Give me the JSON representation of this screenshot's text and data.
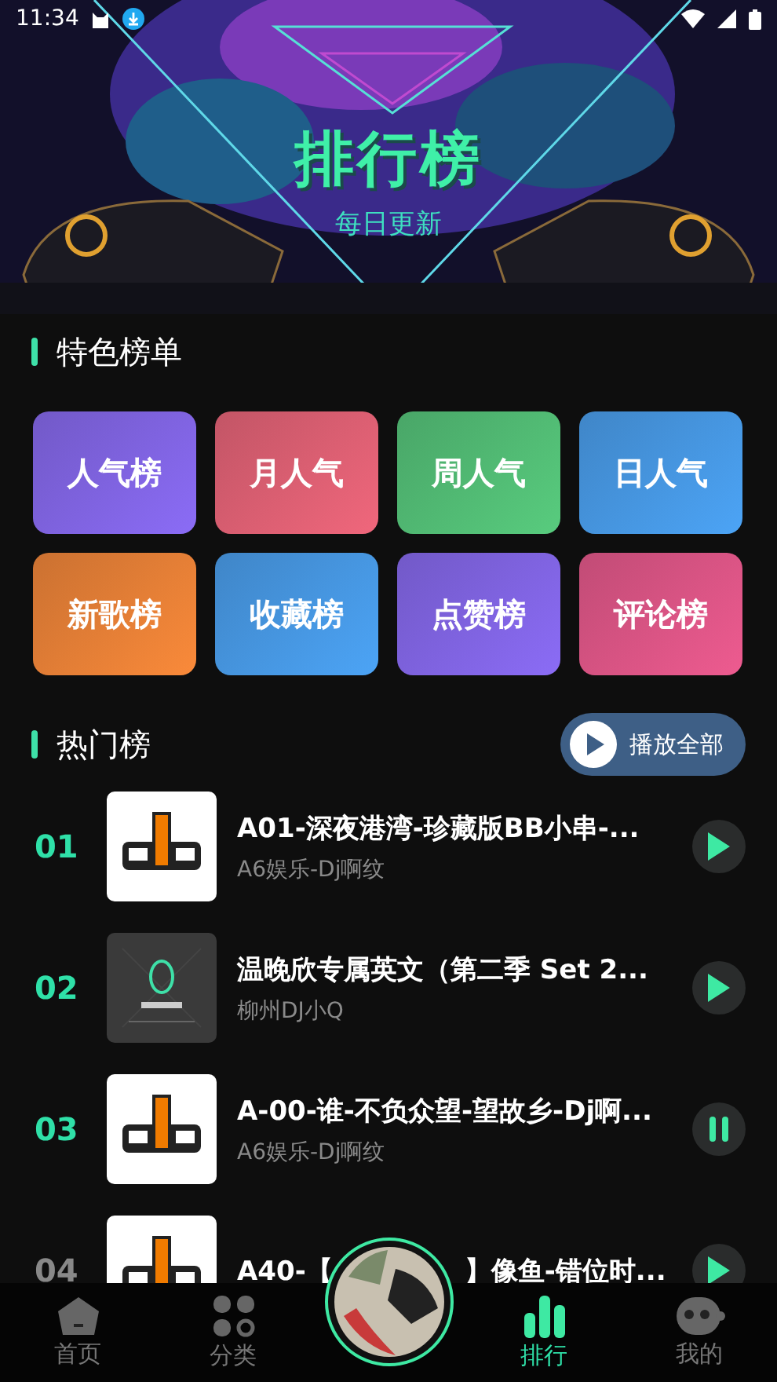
{
  "status_bar": {
    "time": "11:34"
  },
  "banner": {
    "title": "排行榜",
    "subtitle": "每日更新"
  },
  "featured": {
    "heading": "特色榜单",
    "tiles": [
      {
        "label": "人气榜",
        "color": "#8b6cf6"
      },
      {
        "label": "月人气",
        "color": "#f0677c"
      },
      {
        "label": "周人气",
        "color": "#58cc7e"
      },
      {
        "label": "日人气",
        "color": "#4ca4f6"
      },
      {
        "label": "新歌榜",
        "color": "#fa8a3a"
      },
      {
        "label": "收藏榜",
        "color": "#4ca4f6"
      },
      {
        "label": "点赞榜",
        "color": "#8b6cf6"
      },
      {
        "label": "评论榜",
        "color": "#ee5b90"
      }
    ]
  },
  "hot": {
    "heading": "热门榜",
    "play_all": "播放全部",
    "tracks": [
      {
        "rank": "01",
        "title": "A01-深夜港湾-珍藏版BB小串-...",
        "artist": "A6娱乐-Dj啊纹",
        "playing": false
      },
      {
        "rank": "02",
        "title": "温晚欣专属英文（第二季 Set 2...",
        "artist": "柳州DJ小Q",
        "playing": false
      },
      {
        "rank": "03",
        "title": "A-00-谁-不负众望-望故乡-Dj啊...",
        "artist": "A6娱乐-Dj啊纹",
        "playing": true
      },
      {
        "rank": "04",
        "title_start": "A40-【",
        "title_end": "】像鱼-错位时...",
        "playing": false
      }
    ]
  },
  "nav": [
    {
      "label": "首页",
      "selected": false,
      "kind": "home"
    },
    {
      "label": "分类",
      "selected": false,
      "kind": "grid"
    },
    {
      "kind": "disc"
    },
    {
      "label": "排行",
      "selected": true,
      "kind": "chart"
    },
    {
      "label": "我的",
      "selected": false,
      "kind": "face"
    }
  ]
}
